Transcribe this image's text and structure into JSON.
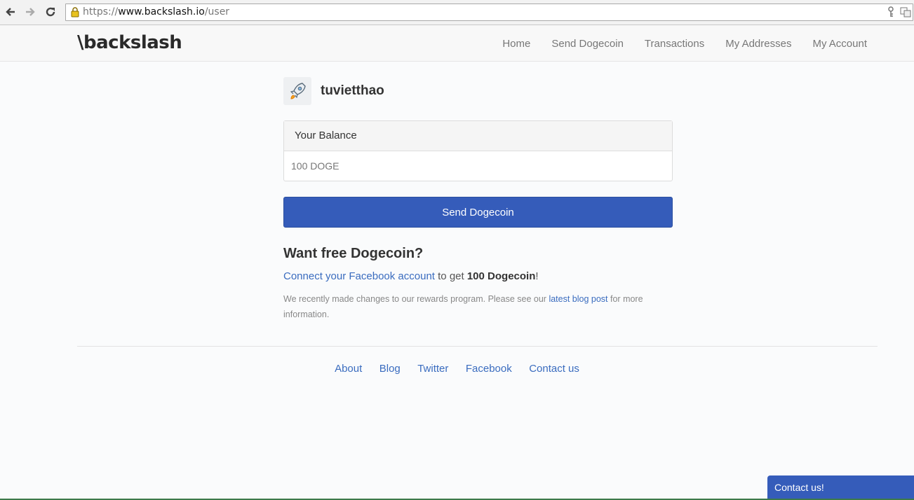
{
  "browser": {
    "url_scheme": "https://",
    "url_host": "www.backslash.io",
    "url_path": "/user"
  },
  "header": {
    "logo": "\\backslash",
    "nav": [
      "Home",
      "Send Dogecoin",
      "Transactions",
      "My Addresses",
      "My Account"
    ]
  },
  "profile": {
    "username": "tuvietthao",
    "avatar_icon": "rocket-icon"
  },
  "balance": {
    "heading": "Your Balance",
    "value": "100 DOGE"
  },
  "send_button": "Send Dogecoin",
  "promo": {
    "heading": "Want free Dogecoin?",
    "link_text": "Connect your Facebook account",
    "text_mid": " to get ",
    "bold_amount": "100 Dogecoin",
    "text_end": "!",
    "note_start": "We recently made changes to our rewards program. Please see our ",
    "note_link": "latest blog post",
    "note_end": " for more information."
  },
  "footer": {
    "links": [
      "About",
      "Blog",
      "Twitter",
      "Facebook",
      "Contact us"
    ]
  },
  "contact_widget": "Contact us!",
  "colors": {
    "accent": "#355cba",
    "link": "#3a6cbf"
  }
}
